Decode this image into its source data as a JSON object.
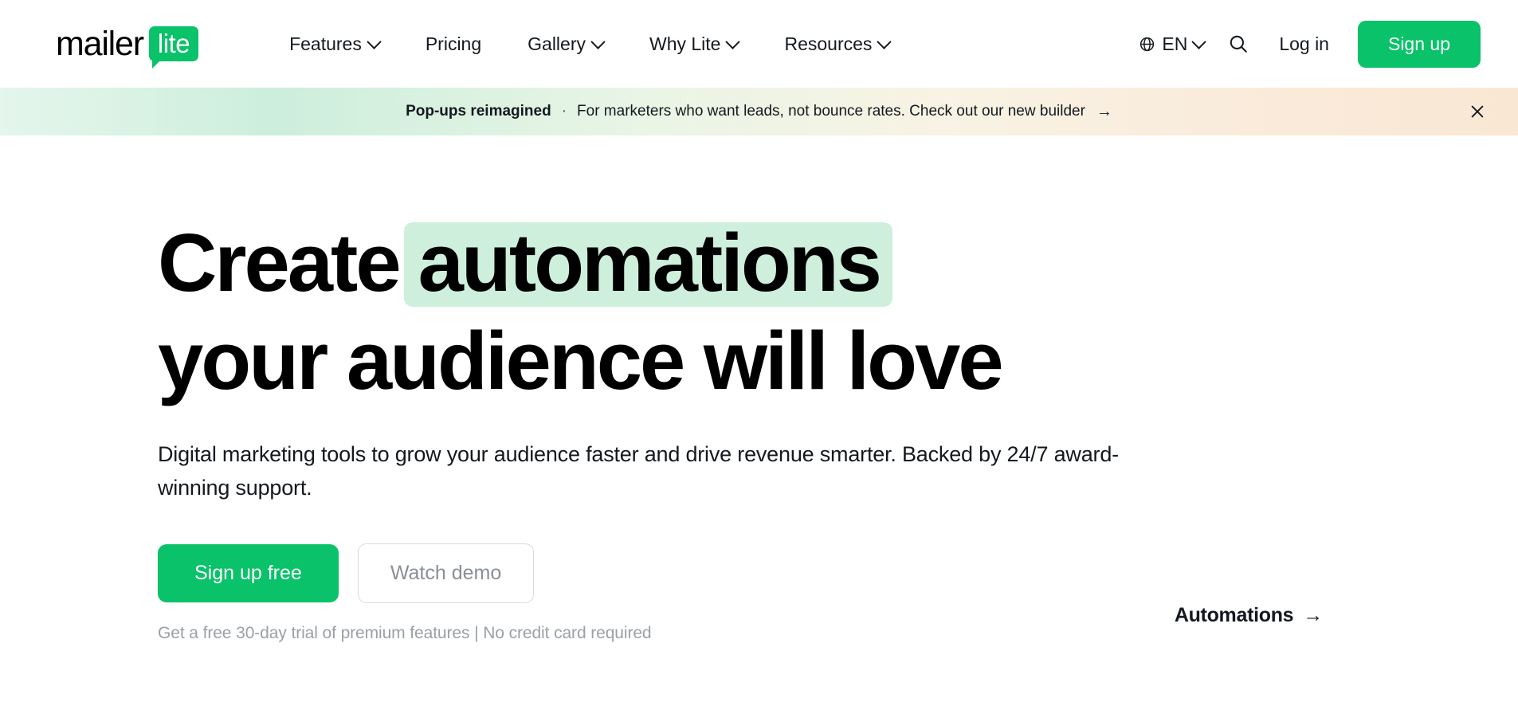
{
  "brand": {
    "logo_word": "mailer",
    "logo_badge": "lite",
    "green": "#09C269",
    "highlight_green": "#cdefdb"
  },
  "header": {
    "nav": [
      {
        "label": "Features",
        "has_dropdown": true
      },
      {
        "label": "Pricing",
        "has_dropdown": false
      },
      {
        "label": "Gallery",
        "has_dropdown": true
      },
      {
        "label": "Why Lite",
        "has_dropdown": true
      },
      {
        "label": "Resources",
        "has_dropdown": true
      }
    ],
    "language": "EN",
    "language_icon": "globe-icon",
    "search_icon": "search-icon",
    "login_label": "Log in",
    "signup_label": "Sign up"
  },
  "banner": {
    "strong": "Pop-ups reimagined",
    "separator": "·",
    "text": "For marketers who want leads, not bounce rates. Check out our new builder",
    "arrow": "→",
    "close_icon": "close-icon"
  },
  "hero": {
    "heading_part1": "Create",
    "heading_highlight": "automations",
    "heading_line2": "your audience will love",
    "lede": "Digital marketing tools to grow your audience faster and drive revenue smarter. Backed by 24/7 award-winning support.",
    "primary_cta": "Sign up free",
    "secondary_cta": "Watch demo",
    "fineprint": "Get a free 30-day trial of premium features | No credit card required",
    "feature_tag": "Automations",
    "feature_tag_arrow": "→"
  }
}
